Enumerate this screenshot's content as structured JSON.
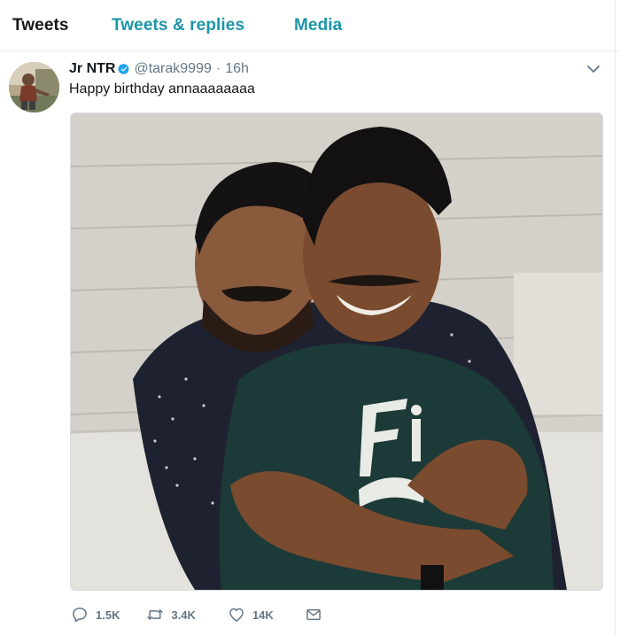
{
  "tabs": [
    {
      "label": "Tweets",
      "active": true
    },
    {
      "label": "Tweets & replies",
      "active": false
    },
    {
      "label": "Media",
      "active": false
    }
  ],
  "tweet": {
    "display_name": "Jr NTR",
    "handle": "@tarak9999",
    "separator": "·",
    "time": "16h",
    "text": "Happy birthday annaaaaaaaa",
    "verified": true
  },
  "actions": {
    "replies": "1.5K",
    "retweets": "3.4K",
    "likes": "14K"
  },
  "colors": {
    "accent": "#1b95a8",
    "verified": "#1da1f2",
    "muted": "#657786"
  },
  "icons": [
    "verified-badge-icon",
    "caret-down-icon",
    "reply-icon",
    "retweet-icon",
    "like-icon",
    "direct-message-icon"
  ]
}
